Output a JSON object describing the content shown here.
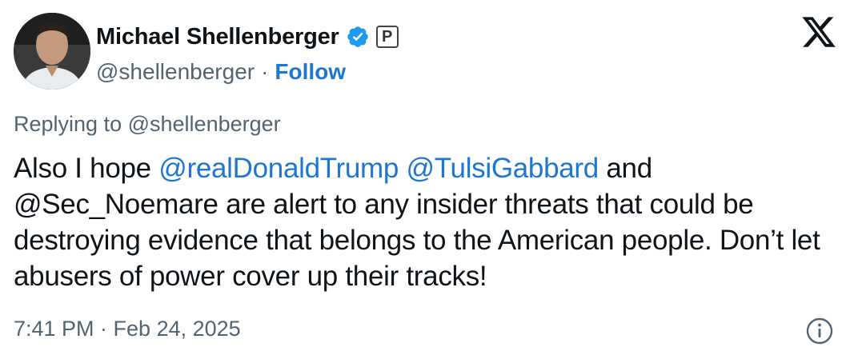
{
  "author": {
    "display_name": "Michael Shellenberger",
    "handle": "@shellenberger",
    "separator": "·",
    "follow_label": "Follow",
    "affiliation_badge": "P",
    "verified_icon": "verified-badge-icon",
    "verified_color": "#1d9bf0"
  },
  "brand": {
    "logo_icon": "x-logo-icon"
  },
  "reply": {
    "prefix": "Replying to",
    "target": "@shellenberger"
  },
  "tweet": {
    "text_part1": "Also I hope ",
    "mention1": "@realDonaldTrump",
    "text_part2": " ",
    "mention2": "@TulsiGabbard",
    "text_part3": " and @Sec_Noemare are alert to any insider threats that could be destroying evidence that belongs to the American people. Don’t let abusers of power cover up their tracks!",
    "timestamp": "7:41 PM · Feb 24, 2025"
  },
  "colors": {
    "link": "#1d76d2",
    "secondary_text": "#536471",
    "primary_text": "#0f1419"
  },
  "info_icon": "info-icon"
}
